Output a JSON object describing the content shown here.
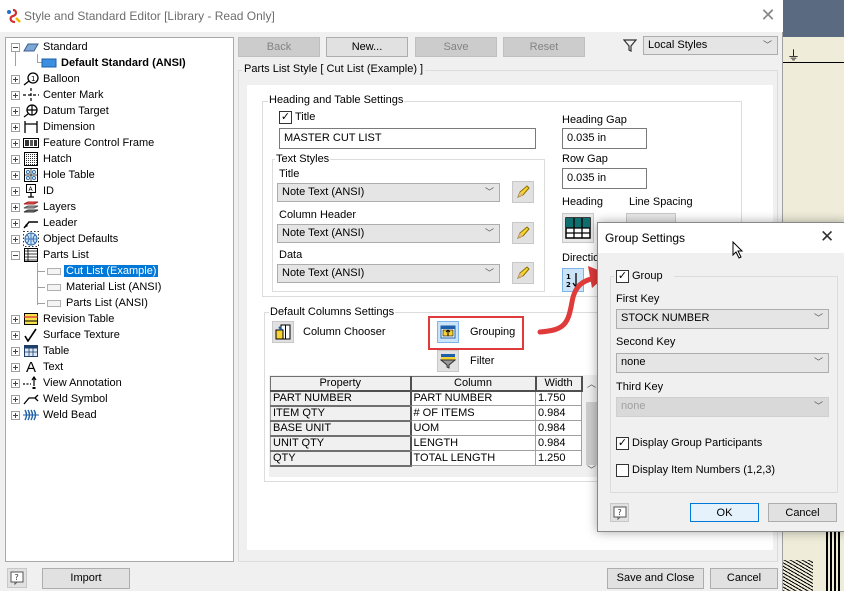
{
  "window": {
    "title": "Style and Standard Editor [Library - Read Only]",
    "close_icon": "close-icon"
  },
  "tree": {
    "items": [
      {
        "label": "Standard",
        "icon": "standard-icon",
        "expanded": true
      },
      {
        "label": "Default Standard (ANSI)",
        "icon": "standard-sheet-icon",
        "bold": true,
        "child": true
      },
      {
        "label": "Balloon",
        "icon": "balloon-icon"
      },
      {
        "label": "Center Mark",
        "icon": "center-mark-icon"
      },
      {
        "label": "Datum Target",
        "icon": "datum-target-icon"
      },
      {
        "label": "Dimension",
        "icon": "dimension-icon"
      },
      {
        "label": "Feature Control Frame",
        "icon": "feature-control-frame-icon"
      },
      {
        "label": "Hatch",
        "icon": "hatch-icon"
      },
      {
        "label": "Hole Table",
        "icon": "hole-table-icon"
      },
      {
        "label": "ID",
        "icon": "id-icon"
      },
      {
        "label": "Layers",
        "icon": "layers-icon"
      },
      {
        "label": "Leader",
        "icon": "leader-icon"
      },
      {
        "label": "Object Defaults",
        "icon": "object-defaults-icon"
      },
      {
        "label": "Parts List",
        "icon": "parts-list-icon",
        "expanded": true
      },
      {
        "label": "Cut List (Example)",
        "child": true,
        "selected": true
      },
      {
        "label": "Material List (ANSI)",
        "child": true
      },
      {
        "label": "Parts List (ANSI)",
        "child": true
      },
      {
        "label": "Revision Table",
        "icon": "revision-table-icon"
      },
      {
        "label": "Surface Texture",
        "icon": "surface-texture-icon"
      },
      {
        "label": "Table",
        "icon": "table-icon"
      },
      {
        "label": "Text",
        "icon": "text-icon"
      },
      {
        "label": "View Annotation",
        "icon": "view-annotation-icon"
      },
      {
        "label": "Weld Symbol",
        "icon": "weld-symbol-icon"
      },
      {
        "label": "Weld Bead",
        "icon": "weld-bead-icon"
      }
    ]
  },
  "toolbar": {
    "back": "Back",
    "new": "New...",
    "save": "Save",
    "reset": "Reset",
    "filter_value": "Local Styles"
  },
  "style": {
    "group_title": "Parts List Style [ Cut List (Example) ]",
    "heading_table": {
      "title": "Heading and Table Settings",
      "title_checkbox_label": "Title",
      "title_checked": true,
      "title_value": "MASTER CUT LIST",
      "heading_gap_label": "Heading Gap",
      "heading_gap_value": "0.035 in",
      "row_gap_label": "Row Gap",
      "row_gap_value": "0.035 in",
      "heading_label": "Heading",
      "line_spacing_label": "Line Spacing",
      "direction_label": "Direction"
    },
    "text_styles": {
      "title": "Text Styles",
      "title_label": "Title",
      "title_value": "Note Text (ANSI)",
      "column_header_label": "Column Header",
      "column_header_value": "Note Text (ANSI)",
      "data_label": "Data",
      "data_value": "Note Text (ANSI)"
    },
    "columns": {
      "title": "Default Columns Settings",
      "column_chooser": "Column Chooser",
      "grouping": "Grouping",
      "filter": "Filter",
      "headers": [
        "Property",
        "Column",
        "Width"
      ],
      "rows": [
        [
          "PART NUMBER",
          "PART NUMBER",
          "1.750"
        ],
        [
          "ITEM QTY",
          "# OF ITEMS",
          "0.984"
        ],
        [
          "BASE UNIT",
          "UOM",
          "0.984"
        ],
        [
          "UNIT QTY",
          "LENGTH",
          "0.984"
        ],
        [
          "QTY",
          "TOTAL LENGTH",
          "1.250"
        ]
      ]
    }
  },
  "footer": {
    "import": "Import",
    "save_and_close": "Save and Close",
    "cancel": "Cancel"
  },
  "group_dialog": {
    "title": "Group Settings",
    "group_label": "Group",
    "group_checked": true,
    "first_key_label": "First Key",
    "first_key_value": "STOCK NUMBER",
    "second_key_label": "Second Key",
    "second_key_value": "none",
    "third_key_label": "Third Key",
    "third_key_value": "none",
    "display_participants_label": "Display Group Participants",
    "display_participants_checked": true,
    "display_item_numbers_label": "Display Item Numbers (1,2,3)",
    "display_item_numbers_checked": false,
    "ok": "OK",
    "cancel": "Cancel"
  },
  "colors": {
    "selection": "#0078d7",
    "annotation_red": "#e03a3a"
  }
}
